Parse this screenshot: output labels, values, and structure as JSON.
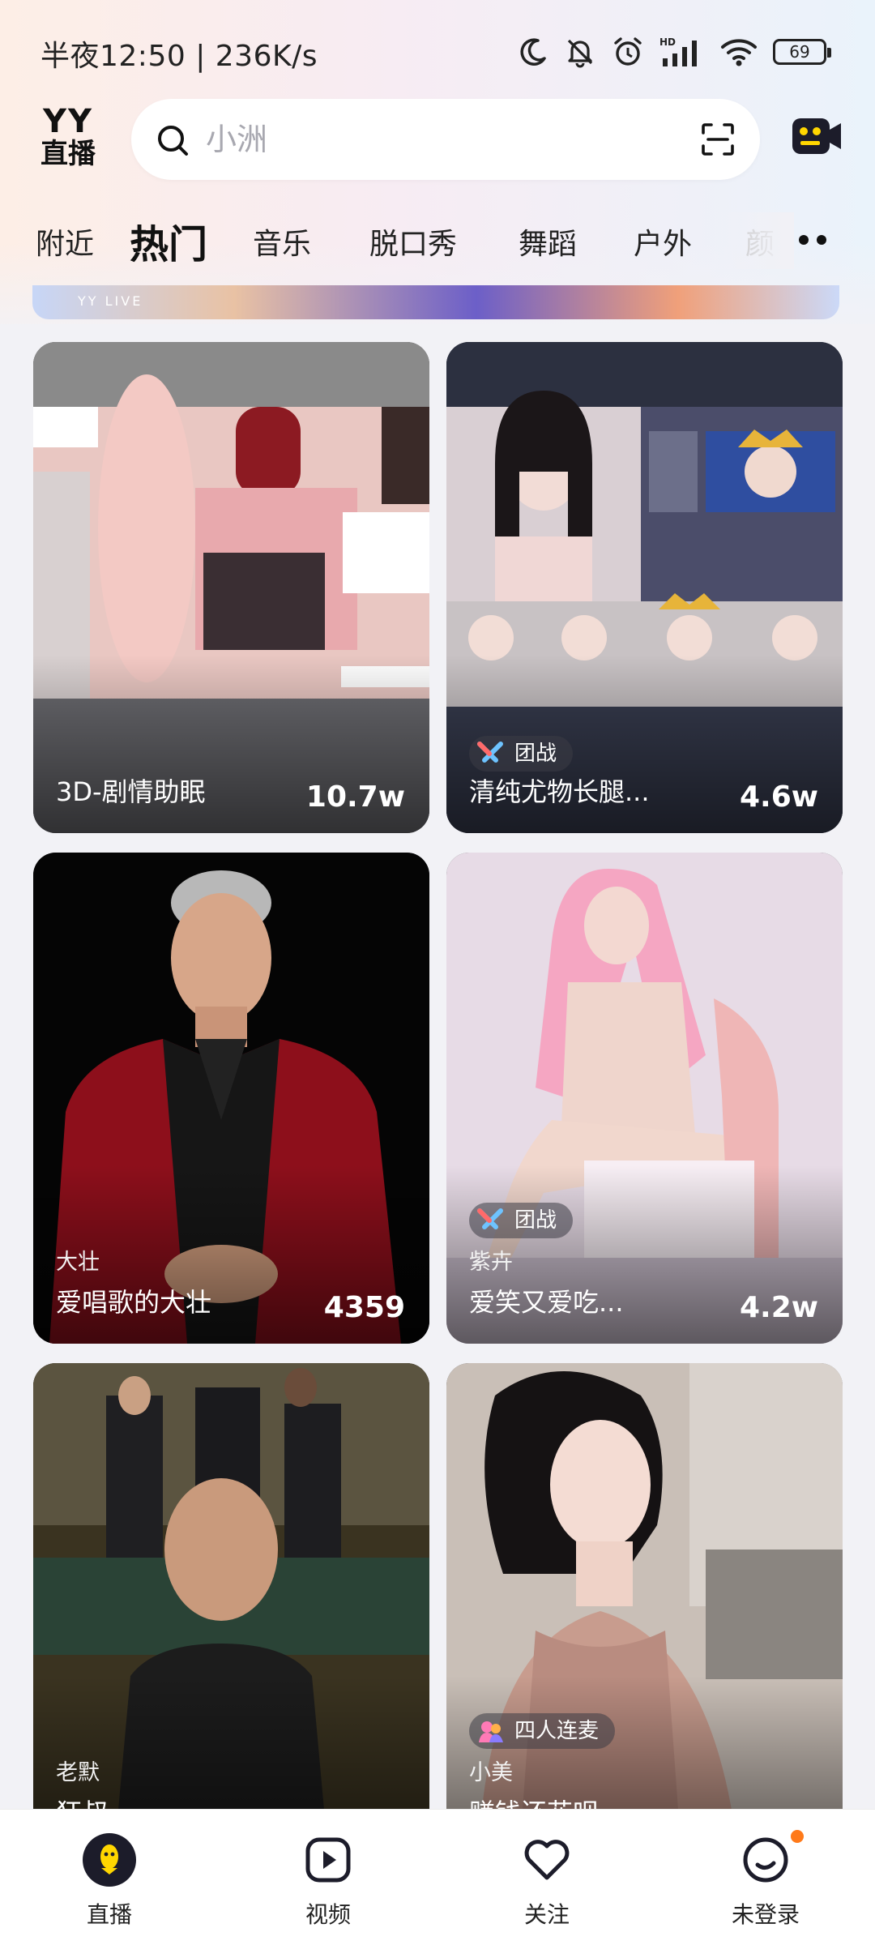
{
  "status_bar": {
    "time": "半夜12:50 | 236K/s",
    "battery": "69",
    "icons": [
      "moon-icon",
      "bell-muted-icon",
      "alarm-icon",
      "hd-signal-icon",
      "wifi-icon",
      "battery-icon"
    ]
  },
  "header": {
    "logo_top": "YY",
    "logo_bottom": "直播",
    "search_placeholder": "小洲",
    "icons": [
      "search-icon",
      "scan-icon",
      "camera-icon"
    ]
  },
  "tabs": [
    {
      "label": "附近"
    },
    {
      "label": "热门",
      "active": true
    },
    {
      "label": "音乐"
    },
    {
      "label": "脱口秀"
    },
    {
      "label": "舞蹈"
    },
    {
      "label": "户外"
    },
    {
      "label": "颜"
    }
  ],
  "banner": {
    "text": "YY LIVE"
  },
  "cards": [
    {
      "title": "3D-剧情助眠",
      "count": "10.7w",
      "streamer": "",
      "badge": ""
    },
    {
      "title": "清纯尤物长腿...",
      "count": "4.6w",
      "streamer": "",
      "badge": "团战"
    },
    {
      "title": "爱唱歌的大壮",
      "count": "4359",
      "streamer": "大壮",
      "badge": ""
    },
    {
      "title": "爱笑又爱吃...",
      "count": "4.2w",
      "streamer": "紫卉",
      "badge": "团战"
    },
    {
      "title": "狂叔",
      "count": "",
      "streamer": "老默",
      "badge": ""
    },
    {
      "title": "赚钱还花呗",
      "count": "",
      "streamer": "小美",
      "badge": "四人连麦"
    }
  ],
  "bottom_nav": [
    {
      "label": "直播",
      "icon": "live-icon",
      "active": true
    },
    {
      "label": "视频",
      "icon": "video-play-icon"
    },
    {
      "label": "关注",
      "icon": "heart-icon"
    },
    {
      "label": "未登录",
      "icon": "profile-icon",
      "notification_dot": true
    }
  ],
  "colors": {
    "accent_yellow": "#ffd600",
    "nav_dark": "#1c1c2a",
    "notification": "#ff7a1a"
  }
}
